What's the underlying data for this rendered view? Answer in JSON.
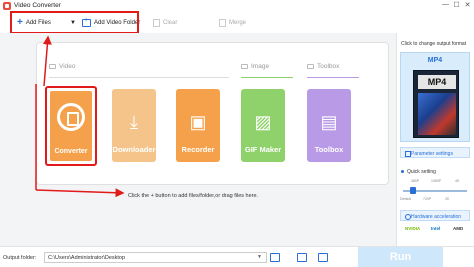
{
  "window": {
    "title": "Video Converter",
    "controls": [
      "—",
      "☐",
      "✕"
    ]
  },
  "toolbar": {
    "add_files": "Add Files",
    "add_video_folder": "Add Video Folder",
    "clear": "Clear",
    "merge": "Merge"
  },
  "sections": {
    "video": "Video",
    "image": "Image",
    "toolbox": "Toolbox"
  },
  "tiles": [
    {
      "label": "Converter",
      "color": "#f5a04a",
      "icon": "converter-icon"
    },
    {
      "label": "Downloader",
      "color": "#f5c48a",
      "icon": "download-icon"
    },
    {
      "label": "Recorder",
      "color": "#f5a04a",
      "icon": "recorder-icon"
    },
    {
      "label": "GIF Maker",
      "color": "#8fd16a",
      "icon": "image-icon"
    },
    {
      "label": "Toolbox",
      "color": "#b99ae6",
      "icon": "toolbox-icon"
    }
  ],
  "hint": "Click the + button to add files/folder,or drag files here.",
  "right_panel": {
    "title": "Click to change output format",
    "format": "MP4",
    "format_badge": "MP4",
    "parameter_settings": "Parameter settings",
    "quick_setting": "Quick setting",
    "quality_ticks": [
      "480P",
      "1080P",
      "4K"
    ],
    "quality_sub": [
      "Default",
      "720P",
      "2K"
    ],
    "quality_level": 0.15,
    "hardware_acceleration": "Hardware acceleration",
    "vendors": [
      {
        "name": "NVIDIA",
        "color": "#76b900"
      },
      {
        "name": "Intel",
        "color": "#0071c5"
      },
      {
        "name": "AMD",
        "color": "#333333"
      }
    ]
  },
  "bottom": {
    "output_folder_label": "Output folder:",
    "output_path": "C:\\Users\\Administrator\\Desktop",
    "run": "Run"
  },
  "colors": {
    "accent": "#2b6fd6",
    "annotation": "#e11a1a"
  }
}
